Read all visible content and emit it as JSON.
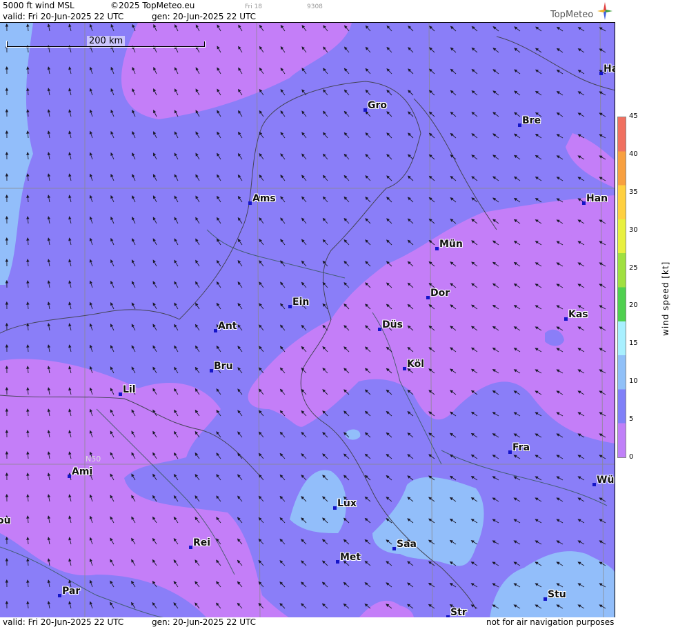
{
  "header": {
    "product": "5000 ft wind MSL",
    "copyright": "©2025 TopMeteo.eu",
    "tiny_day": "Fri 18",
    "tiny_code": "9308",
    "valid": "valid:  Fri  20-Jun-2025  22 UTC",
    "gen": "gen: 20-Jun-2025 22 UTC",
    "logo": "TopMeteo"
  },
  "footer": {
    "valid": "valid:  Fri  20-Jun-2025  22 UTC",
    "gen": "gen: 20-Jun-2025 22 UTC",
    "disclaimer": "not for air navigation purposes"
  },
  "map": {
    "scale_label": "200 km",
    "grid_label": "N50",
    "cities": [
      {
        "name": "Ha"
      },
      {
        "name": "Gro"
      },
      {
        "name": "Bre"
      },
      {
        "name": "Ams"
      },
      {
        "name": "Han"
      },
      {
        "name": "Mün"
      },
      {
        "name": "Dor"
      },
      {
        "name": "Ein"
      },
      {
        "name": "Kas"
      },
      {
        "name": "Ant"
      },
      {
        "name": "Düs"
      },
      {
        "name": "Bru"
      },
      {
        "name": "Köl"
      },
      {
        "name": "Lil"
      },
      {
        "name": "Fra"
      },
      {
        "name": "Ami"
      },
      {
        "name": "Wü"
      },
      {
        "name": "Lux"
      },
      {
        "name": "ou"
      },
      {
        "name": "Rei"
      },
      {
        "name": "Saa"
      },
      {
        "name": "Met"
      },
      {
        "name": "Par"
      },
      {
        "name": "Stu"
      },
      {
        "name": "Str"
      }
    ]
  },
  "legend": {
    "unit": "wind  speed  [kt]",
    "ticks": [
      "45",
      "40",
      "35",
      "30",
      "25",
      "20",
      "15",
      "10",
      "5",
      "0"
    ],
    "colors": [
      "#f07060",
      "#f8a040",
      "#ffd040",
      "#e8f040",
      "#a0e040",
      "#50d050",
      "#a8f0ff",
      "#90c0f8",
      "#8080f8",
      "#c080f8"
    ]
  },
  "palette": {
    "light_purple": "#c47ef8",
    "blue_purple": "#8a7ef8",
    "light_blue": "#92befa"
  }
}
